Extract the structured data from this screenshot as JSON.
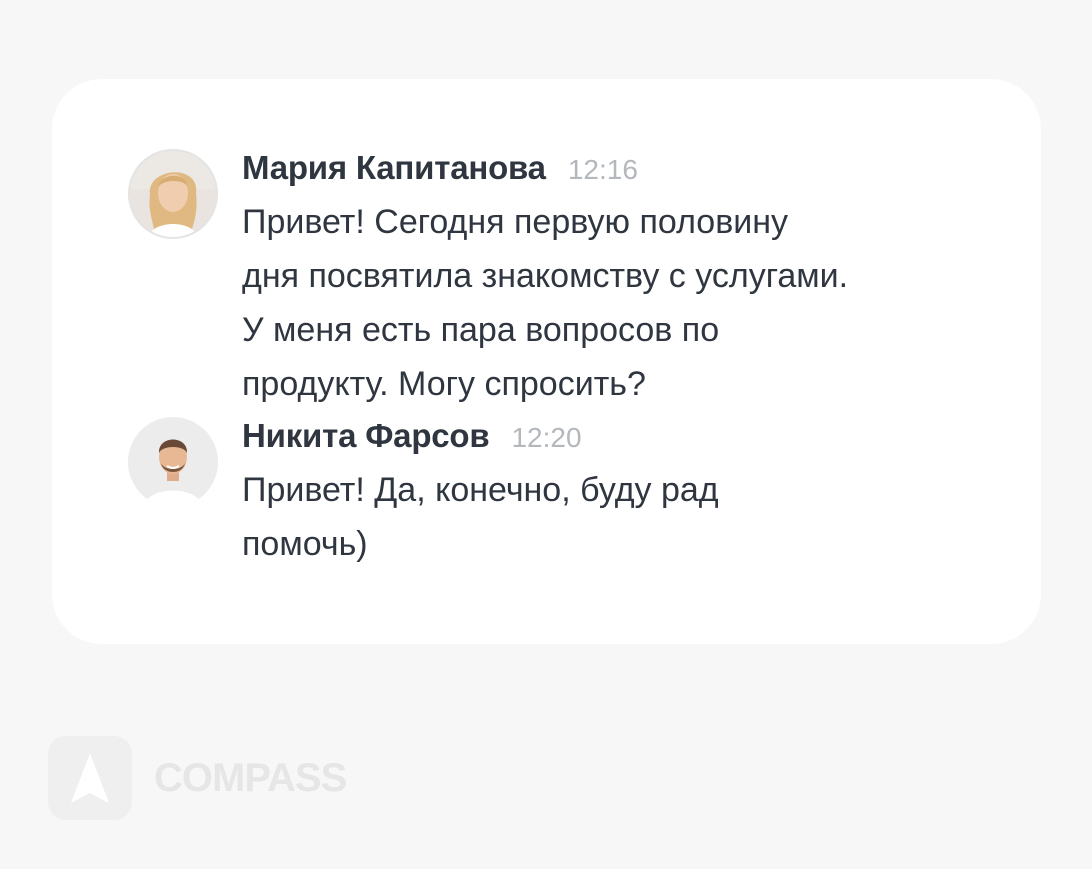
{
  "chat": {
    "messages": [
      {
        "sender": "Мария Капитанова",
        "time": "12:16",
        "text": "Привет! Сегодня первую половину\nдня посвятила знакомству с услугами.\nУ меня есть пара вопросов по\nпродукту. Могу спросить?",
        "avatar_icon": "woman-avatar"
      },
      {
        "sender": "Никита Фарсов",
        "time": "12:20",
        "text": "Привет! Да, конечно, буду рад\nпомочь)",
        "avatar_icon": "man-avatar"
      }
    ]
  },
  "brand": {
    "name": "COMPASS",
    "logo_icon": "compass-arrow-icon"
  },
  "colors": {
    "background": "#f7f7f7",
    "card": "#ffffff",
    "text": "#2f3640",
    "timestamp": "#b4b8bd",
    "brand_watermark": "#e6e6e6"
  }
}
